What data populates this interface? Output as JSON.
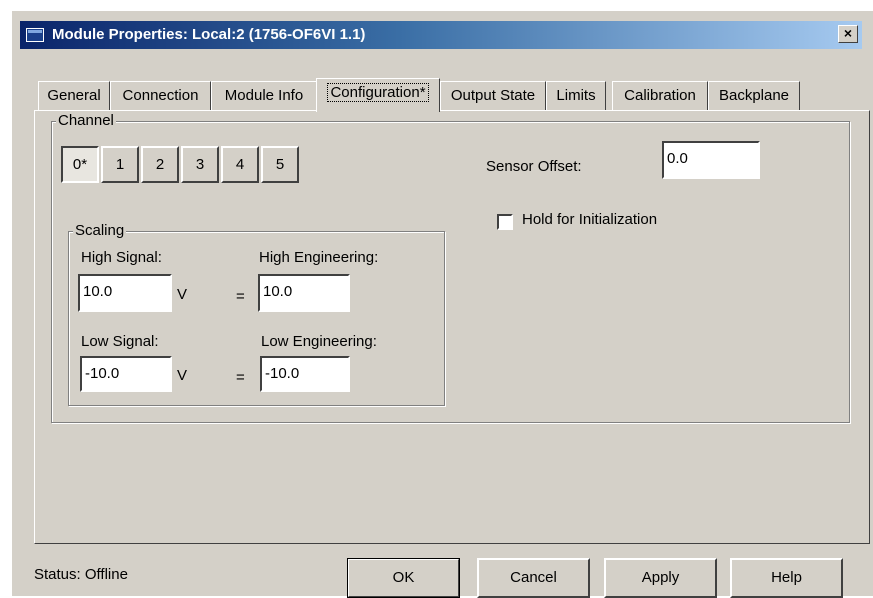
{
  "window": {
    "title": "Module Properties: Local:2 (1756-OF6VI 1.1)",
    "close_glyph": "×"
  },
  "tabs": [
    {
      "label": "General"
    },
    {
      "label": "Connection"
    },
    {
      "label": "Module Info"
    },
    {
      "label": "Configuration*",
      "active": true
    },
    {
      "label": "Output State"
    },
    {
      "label": "Limits"
    },
    {
      "label": "Calibration"
    },
    {
      "label": "Backplane"
    }
  ],
  "channel": {
    "group_label": "Channel",
    "buttons": [
      "0*",
      "1",
      "2",
      "3",
      "4",
      "5"
    ],
    "selected": "0*"
  },
  "scaling": {
    "group_label": "Scaling",
    "high_signal_label": "High Signal:",
    "high_signal_value": "10.0",
    "high_signal_unit": "V",
    "high_eq": "=",
    "high_engineering_label": "High Engineering:",
    "high_engineering_value": "10.0",
    "low_signal_label": "Low Signal:",
    "low_signal_value": "-10.0",
    "low_signal_unit": "V",
    "low_eq": "=",
    "low_engineering_label": "Low Engineering:",
    "low_engineering_value": "-10.0"
  },
  "sensor": {
    "offset_label": "Sensor Offset:",
    "offset_value": "0.0",
    "hold_label": "Hold for Initialization",
    "hold_checked": false
  },
  "footer": {
    "status_text": "Status:  Offline",
    "ok_label": "OK",
    "cancel_label": "Cancel",
    "apply_label": "Apply",
    "help_label": "Help"
  }
}
